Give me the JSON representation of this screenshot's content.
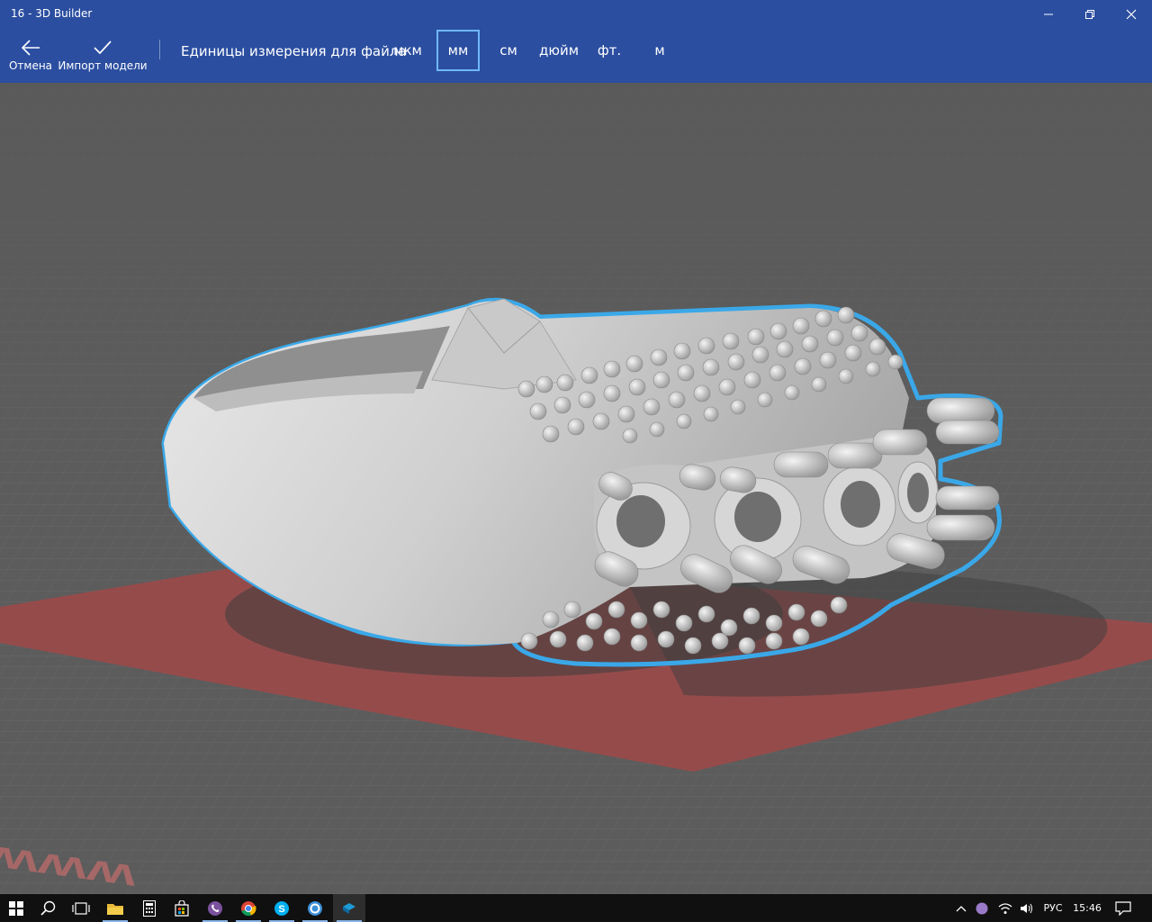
{
  "window": {
    "title": "16 - 3D Builder"
  },
  "commands": {
    "cancel": {
      "label": "Отмена",
      "icon": "back-arrow-icon"
    },
    "import": {
      "label": "Импорт модели",
      "icon": "checkmark-icon"
    }
  },
  "units": {
    "label": "Единицы измерения для файла",
    "options": [
      "мкм",
      "мм",
      "см",
      "дюйм",
      "фт.",
      "м"
    ],
    "selected": "мм"
  },
  "scene": {
    "model": "ring",
    "plate_text": "WWW",
    "colors": {
      "background": "#5a5a5a",
      "grid": "#6a6a6a",
      "plate": "#a04848",
      "model": "#d2d2d2",
      "selection_outline": "#3aa8e8"
    }
  },
  "taskbar": {
    "apps": [
      {
        "name": "start",
        "icon": "windows-logo-icon"
      },
      {
        "name": "search",
        "icon": "search-icon"
      },
      {
        "name": "task-view",
        "icon": "task-view-icon"
      },
      {
        "name": "file-explorer",
        "icon": "folder-icon",
        "active": true
      },
      {
        "name": "calculator",
        "icon": "calculator-icon"
      },
      {
        "name": "store",
        "icon": "store-icon"
      },
      {
        "name": "viber",
        "icon": "viber-icon",
        "active": true
      },
      {
        "name": "chrome",
        "icon": "chrome-icon",
        "active": true
      },
      {
        "name": "skype",
        "icon": "skype-icon",
        "active": true
      },
      {
        "name": "app",
        "icon": "circle-app-icon",
        "active": true
      },
      {
        "name": "3d-builder",
        "icon": "3d-builder-icon",
        "active": true,
        "current": true
      }
    ],
    "tray": {
      "language": "РУС",
      "time": "15:46",
      "icons": [
        "chevron-up-icon",
        "viber-tray-icon",
        "network-icon",
        "volume-icon",
        "notification-icon"
      ]
    }
  }
}
